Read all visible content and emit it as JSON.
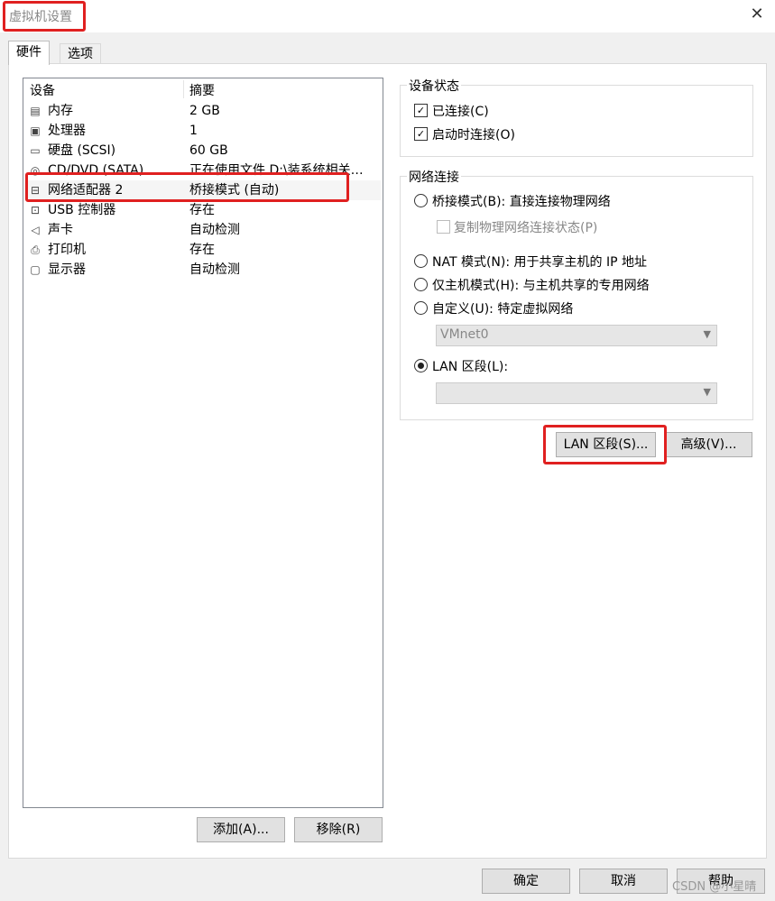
{
  "window": {
    "title": "虚拟机设置",
    "close_icon": "close-icon"
  },
  "tabs": [
    {
      "label": "硬件",
      "active": true
    },
    {
      "label": "选项",
      "active": false
    }
  ],
  "device_list": {
    "columns": [
      "设备",
      "摘要"
    ],
    "rows": [
      {
        "icon": "memory-icon",
        "name": "内存",
        "summary": "2 GB"
      },
      {
        "icon": "cpu-icon",
        "name": "处理器",
        "summary": "1"
      },
      {
        "icon": "hdd-icon",
        "name": "硬盘 (SCSI)",
        "summary": "60 GB"
      },
      {
        "icon": "cd-icon",
        "name": "CD/DVD (SATA)",
        "summary": "正在使用文件 D:\\装系统相关…"
      },
      {
        "icon": "network-icon",
        "name": "网络适配器 2",
        "summary": "桥接模式 (自动)",
        "selected": true
      },
      {
        "icon": "usb-icon",
        "name": "USB 控制器",
        "summary": "存在"
      },
      {
        "icon": "sound-icon",
        "name": "声卡",
        "summary": "自动检测"
      },
      {
        "icon": "printer-icon",
        "name": "打印机",
        "summary": "存在"
      },
      {
        "icon": "display-icon",
        "name": "显示器",
        "summary": "自动检测"
      }
    ]
  },
  "device_buttons": {
    "add": "添加(A)...",
    "remove": "移除(R)"
  },
  "device_status": {
    "title": "设备状态",
    "connected": {
      "label": "已连接(C)",
      "checked": true
    },
    "connect_at_power_on": {
      "label": "启动时连接(O)",
      "checked": true
    }
  },
  "network_connection": {
    "title": "网络连接",
    "bridged": {
      "label": "桥接模式(B): 直接连接物理网络",
      "checked": false
    },
    "replicate": {
      "label": "复制物理网络连接状态(P)",
      "checked": false,
      "enabled": false
    },
    "nat": {
      "label": "NAT 模式(N): 用于共享主机的 IP 地址",
      "checked": false
    },
    "host_only": {
      "label": "仅主机模式(H): 与主机共享的专用网络",
      "checked": false
    },
    "custom": {
      "label": "自定义(U): 特定虚拟网络",
      "checked": false
    },
    "custom_select": "VMnet0",
    "lan_segment": {
      "label": "LAN 区段(L):",
      "checked": true
    },
    "lan_select": ""
  },
  "network_buttons": {
    "lan_segments": "LAN 区段(S)...",
    "advanced": "高级(V)..."
  },
  "dialog_buttons": {
    "ok": "确定",
    "cancel": "取消",
    "help": "帮助"
  },
  "watermark": "CSDN @小星晴",
  "colors": {
    "highlight": "#e02020",
    "selected_row": "#f5f5f5"
  }
}
